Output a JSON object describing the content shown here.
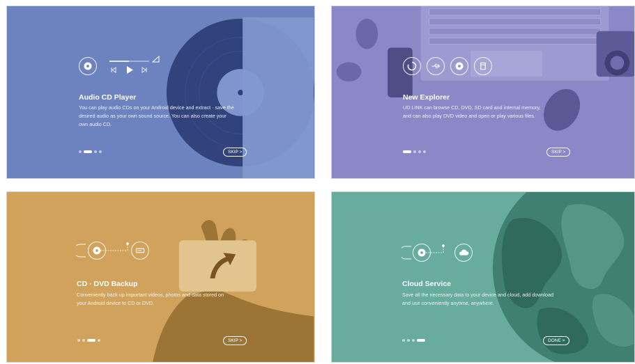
{
  "panels": [
    {
      "title": "Audio CD Player",
      "description": [
        "You can play audio CDs on your Android device and extract · save the",
        "desired audio as your own sound source. You can also create your",
        "own audio CD."
      ],
      "button": "SKIP >",
      "active_dot": 1,
      "color": "#6c83c0"
    },
    {
      "title": "New Explorer",
      "description": [
        "UD LINK can browse CD, DVD, SD card and internal memory,",
        "and can also play DVD video and open or play various files."
      ],
      "button": "SKIP >",
      "active_dot": 0,
      "color": "#8b88c7"
    },
    {
      "title": "CD · DVD Backup",
      "description": [
        "Conveniently back up important videos, photos and data stored on",
        "your Android device to CD or DVD."
      ],
      "button": "SKIP >",
      "active_dot": 2,
      "color": "#d1a25c"
    },
    {
      "title": "Cloud Service",
      "description": [
        "Save all the necessary data to your device and cloud, add download",
        "and use conveniently anytime, anywhere."
      ],
      "button": "DONE >",
      "active_dot": 3,
      "color": "#68ab9f"
    }
  ],
  "icons": {
    "p1": [
      "cd-icon",
      "playback-progress-bar",
      "volume-icon",
      "previous-icon",
      "play-icon",
      "next-icon"
    ],
    "p2": [
      "loading-icon",
      "usb-icon",
      "cd-icon",
      "sd-card-icon"
    ],
    "p3": [
      "cd-icon",
      "drive-icon",
      "upload-arrow-icon"
    ],
    "p4": [
      "cd-icon",
      "cloud-icon"
    ]
  }
}
